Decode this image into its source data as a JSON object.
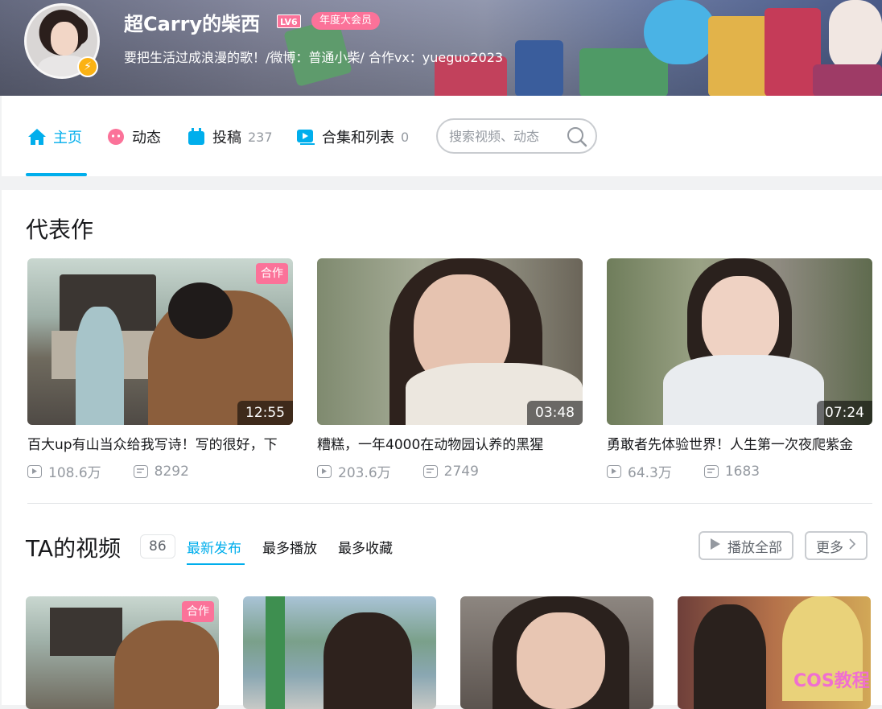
{
  "profile": {
    "name": "超Carry的柴西",
    "level": "LV6",
    "vip_label": "年度大会员",
    "sign": "要把生活过成浪漫的歌！/微博：普通小柴/ 合作vx：yueguo2023"
  },
  "nav": {
    "items": [
      {
        "label": "主页",
        "count": "",
        "icon": "home-icon"
      },
      {
        "label": "动态",
        "count": "",
        "icon": "dynamic-icon"
      },
      {
        "label": "投稿",
        "count": "237",
        "icon": "upload-icon"
      },
      {
        "label": "合集和列表",
        "count": "0",
        "icon": "collection-icon"
      }
    ],
    "search_placeholder": "搜索视频、动态"
  },
  "featured": {
    "title": "代表作",
    "videos": [
      {
        "tag": "合作",
        "duration": "12:55",
        "title": "百大up有山当众给我写诗！写的很好，下",
        "views": "108.6万",
        "danmaku": "8292"
      },
      {
        "tag": "",
        "duration": "03:48",
        "title": "糟糕，一年4000在动物园认养的黑猩",
        "views": "203.6万",
        "danmaku": "2749"
      },
      {
        "tag": "",
        "duration": "07:24",
        "title": "勇敢者先体验世界！人生第一次夜爬紫金",
        "views": "64.3万",
        "danmaku": "1683"
      }
    ]
  },
  "videos_section": {
    "title": "TA的视频",
    "count": "86",
    "tabs": [
      "最新发布",
      "最多播放",
      "最多收藏"
    ],
    "play_all": "播放全部",
    "more": "更多",
    "thumb_tag": "合作"
  },
  "watermark": "COS教程",
  "colors": {
    "accent": "#00aeec",
    "pink": "#fb7299",
    "gray_text": "#9499a0"
  }
}
